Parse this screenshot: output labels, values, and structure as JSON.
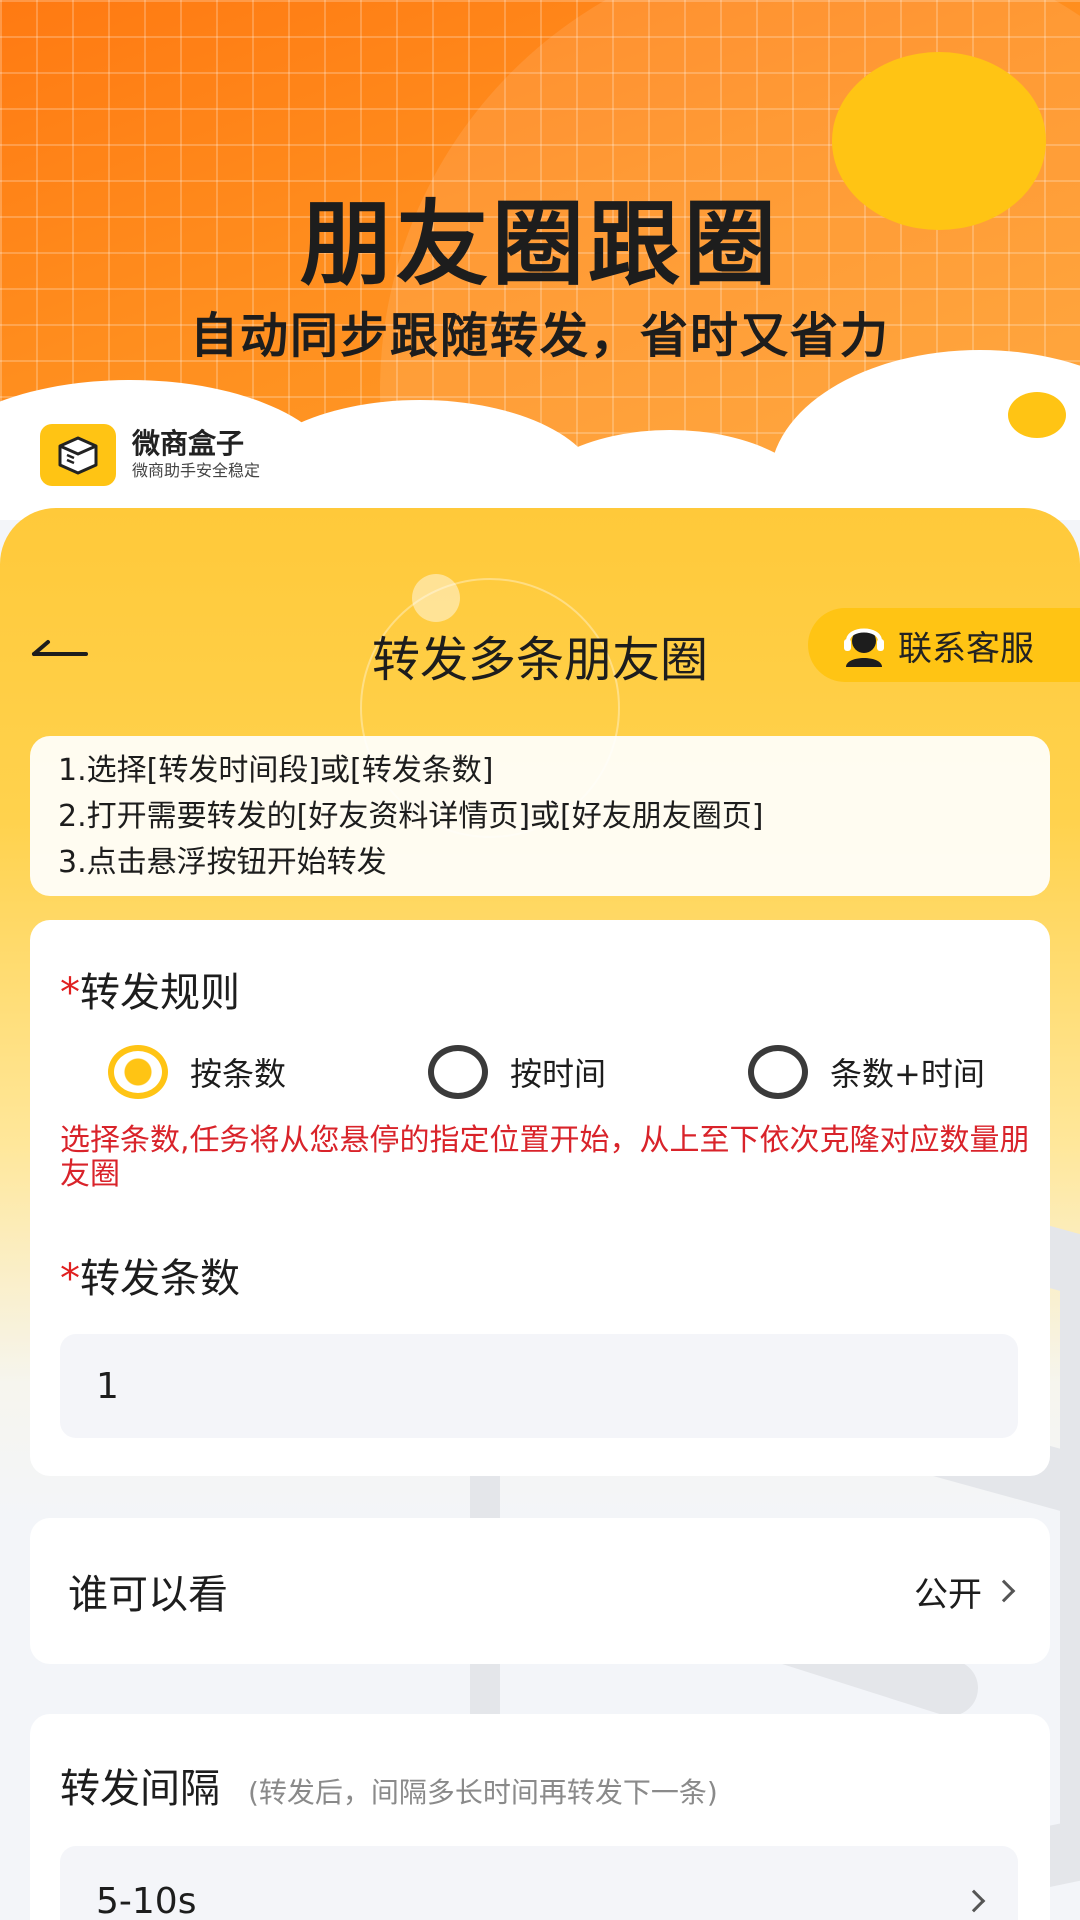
{
  "banner": {
    "title": "朋友圈跟圈",
    "subtitle": "自动同步跟随转发，省时又省力",
    "brand_name": "微商盒子",
    "brand_slogan": "微商助手安全稳定"
  },
  "header": {
    "title": "转发多条朋友圈",
    "support_label": "联系客服"
  },
  "tips": [
    "1.选择[转发时间段]或[转发条数]",
    "2.打开需要转发的[好友资料详情页]或[好友朋友圈页]",
    "3.点击悬浮按钮开始转发"
  ],
  "rule": {
    "required_mark": "*",
    "title": "转发规则",
    "options": [
      "按条数",
      "按时间",
      "条数+时间"
    ],
    "selected": "按条数",
    "warning": "选择条数,任务将从您悬停的指定位置开始，从上至下依次克隆对应数量朋友圈"
  },
  "count": {
    "required_mark": "*",
    "title": "转发条数",
    "value": "1"
  },
  "visibility": {
    "label": "谁可以看",
    "value": "公开"
  },
  "interval": {
    "title": "转发间隔",
    "hint": "(转发后，间隔多长时间再转发下一条)",
    "value": "5-10s"
  },
  "colors": {
    "accent_yellow": "#ffc414",
    "banner_orange": "#ff8f1f",
    "warning_red": "#d9232a"
  }
}
